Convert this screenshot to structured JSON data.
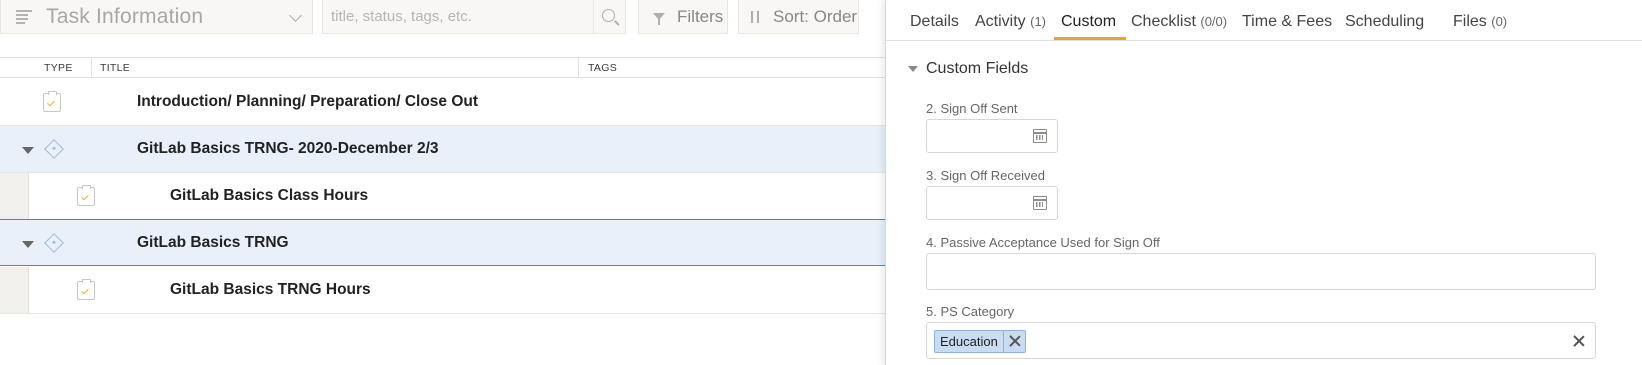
{
  "toolbar": {
    "view_title": "Task Information",
    "search_placeholder": "title, status, tags, etc.",
    "filters_label": "Filters",
    "sort_label": "Sort: Order"
  },
  "table": {
    "columns": [
      "TYPE",
      "TITLE",
      "TAGS"
    ],
    "rows": [
      {
        "type": "task",
        "title": "Introduction/ Planning/ Preparation/ Close Out"
      },
      {
        "type": "milestone",
        "title": "GitLab Basics TRNG- 2020-December 2/3"
      },
      {
        "type": "task",
        "title": "GitLab Basics Class Hours"
      },
      {
        "type": "milestone",
        "title": "GitLab Basics TRNG"
      },
      {
        "type": "task",
        "title": "GitLab Basics TRNG Hours"
      }
    ]
  },
  "panel": {
    "tabs": [
      {
        "label": "Details",
        "count": ""
      },
      {
        "label": "Activity",
        "count": "(1)"
      },
      {
        "label": "Custom",
        "count": ""
      },
      {
        "label": "Checklist",
        "count": "(0/0)"
      },
      {
        "label": "Time & Fees",
        "count": ""
      },
      {
        "label": "Scheduling",
        "count": ""
      },
      {
        "label": "Files",
        "count": "(0)"
      }
    ],
    "active_tab": "Custom",
    "section_title": "Custom Fields",
    "fields": {
      "sign_off_sent": {
        "label": "2. Sign Off Sent",
        "value": ""
      },
      "sign_off_received": {
        "label": "3. Sign Off Received",
        "value": ""
      },
      "passive_acceptance": {
        "label": "4. Passive Acceptance Used for Sign Off",
        "value": ""
      },
      "ps_category": {
        "label": "5. PS Category",
        "tags": [
          "Education"
        ]
      }
    }
  },
  "colors": {
    "accent_tab": "#f0a030",
    "group_row": "#e9f0f9",
    "selected_border": "#4a86c5",
    "tag_bg": "#c8ddf3"
  }
}
